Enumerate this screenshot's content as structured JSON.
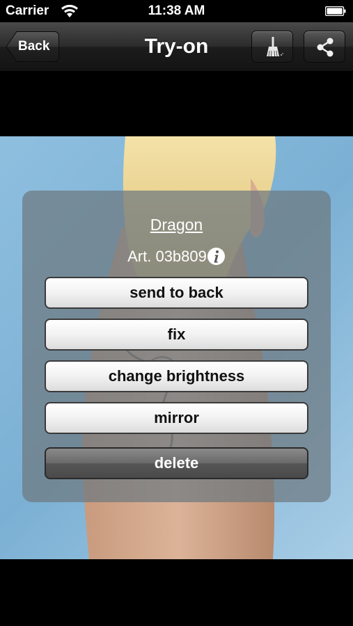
{
  "status_bar": {
    "carrier": "Carrier",
    "time": "11:38 AM"
  },
  "nav": {
    "back_label": "Back",
    "title": "Try-on",
    "clean_icon": "brush-icon",
    "share_icon": "share-icon"
  },
  "panel": {
    "item_name": "Dragon",
    "article": "Art. 03b809",
    "buttons": {
      "send_to_back": "send to back",
      "fix": "fix",
      "change_brightness": "change brightness",
      "mirror": "mirror",
      "delete": "delete"
    }
  },
  "colors": {
    "photo_background": "#8fbfdf",
    "panel_overlay": "#6e7880"
  }
}
